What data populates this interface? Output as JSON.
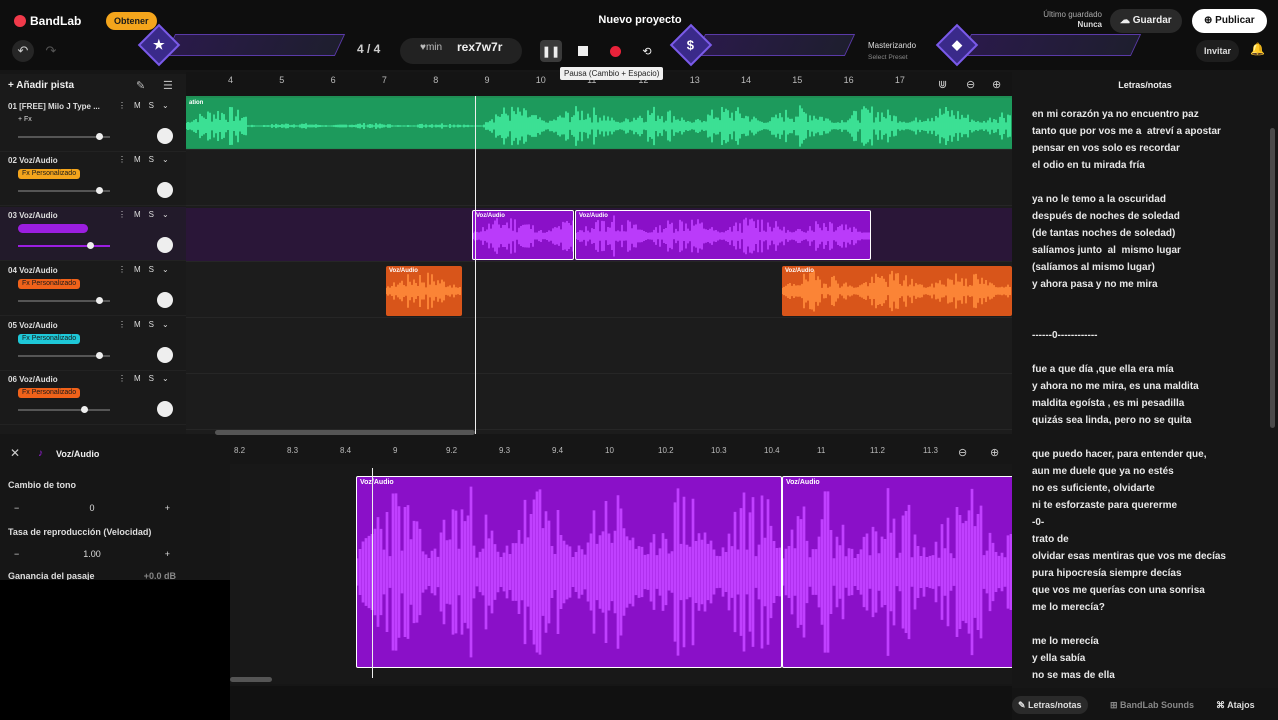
{
  "header": {
    "brand": "BandLab",
    "upgrade_label": "Obtener",
    "project_title": "Nuevo proyecto",
    "saved_status": "Último guardado",
    "saved_when": "Nunca",
    "save_label": "Guardar",
    "publish_label": "Publicar",
    "invite_label": "Invitar"
  },
  "toolbar": {
    "time_signature": "4 / 4",
    "metronome_unit": "min",
    "tempo_text": "rex7w7r",
    "pause_tooltip": "Pausa (Cambio + Espacio)",
    "mastering_label": "Masterizando",
    "mastering_preset": "Select Preset"
  },
  "tracks_panel": {
    "add_track_label": "Añadir pista",
    "tracks": [
      {
        "name": "01 [FREE] Milo J Type ...",
        "fx": "+ Fx",
        "color": "#22c77a",
        "volume": 0.88,
        "fx_color": ""
      },
      {
        "name": "02 Voz/Audio",
        "fx": "Fx Personalizado",
        "color": "#f4a51c",
        "volume": 0.88,
        "fx_color": "#f4a51c"
      },
      {
        "name": "03 Voz/Audio",
        "fx": "",
        "color": "#9b1ee0",
        "volume": 0.78,
        "fx_color": "#9b1ee0"
      },
      {
        "name": "04 Voz/Audio",
        "fx": "Fx Personalizado",
        "color": "#f0621a",
        "volume": 0.88,
        "fx_color": "#f0621a"
      },
      {
        "name": "05 Voz/Audio",
        "fx": "Fx Personalizado",
        "color": "#1ec8d8",
        "volume": 0.88,
        "fx_color": "#1ec8d8"
      },
      {
        "name": "06 Voz/Audio",
        "fx": "Fx Personalizado",
        "color": "#f0621a",
        "volume": 0.72,
        "fx_color": "#f0621a"
      }
    ],
    "mute_label": "M",
    "solo_label": "S"
  },
  "ruler": {
    "bars": [
      "4",
      "5",
      "6",
      "7",
      "8",
      "9",
      "10",
      "11",
      "12",
      "13",
      "14",
      "15",
      "16",
      "17"
    ]
  },
  "clips": {
    "track1_label": "ation",
    "voz_audio": "Voz/Audio"
  },
  "editor": {
    "track_name": "Voz/Audio",
    "pitch_label": "Cambio de tono",
    "pitch_value": "0",
    "rate_label": "Tasa de reproducción (Velocidad)",
    "rate_value": "1.00",
    "gain_label": "Ganancia del pasaje",
    "gain_value": "+0.0 dB",
    "ruler_ticks": [
      "8.2",
      "8.3",
      "8.4",
      "9",
      "9.2",
      "9.3",
      "9.4",
      "10",
      "10.2",
      "10.3",
      "10.4",
      "11",
      "11.2",
      "11.3"
    ],
    "clip_label": "Voz/Audio"
  },
  "lyrics": {
    "title": "Letras/notas",
    "text": "en mi corazón ya no encuentro paz\ntanto que por vos me a  atreví a apostar\npensar en vos solo es recordar\nel odio en tu mirada fría\n\nya no le temo a la oscuridad\ndespués de noches de soledad\n(de tantas noches de soledad)\nsalíamos junto  al  mismo lugar\n(salíamos al mismo lugar)\ny ahora pasa y no me mira\n\n\n------0------------\n\nfue a que día ,que ella era mía\ny ahora no me mira, es una maldita\nmaldita egoísta , es mi pesadilla\nquizás sea linda, pero no se quita\n\nque puedo hacer, para entender que,\naun me duele que ya no estés\nno es suficiente, olvidarte\nni te esforzaste para quererme\n-0-\ntrato de\nolvidar esas mentiras que vos me decías\npura hipocresía siempre decías\nque vos me querías con una sonrisa\nme lo merecía?\n\nme lo merecía\ny ella sabía\nno se mas de ella"
  },
  "bottom_tabs": {
    "lyrics_tab": "Letras/notas",
    "sounds_tab": "BandLab Sounds",
    "shortcuts_tab": "Atajos"
  },
  "colors": {
    "green": "#22c77a",
    "purple": "#9b1ee0",
    "orange": "#f0621a",
    "accent": "#7a5ae8"
  }
}
